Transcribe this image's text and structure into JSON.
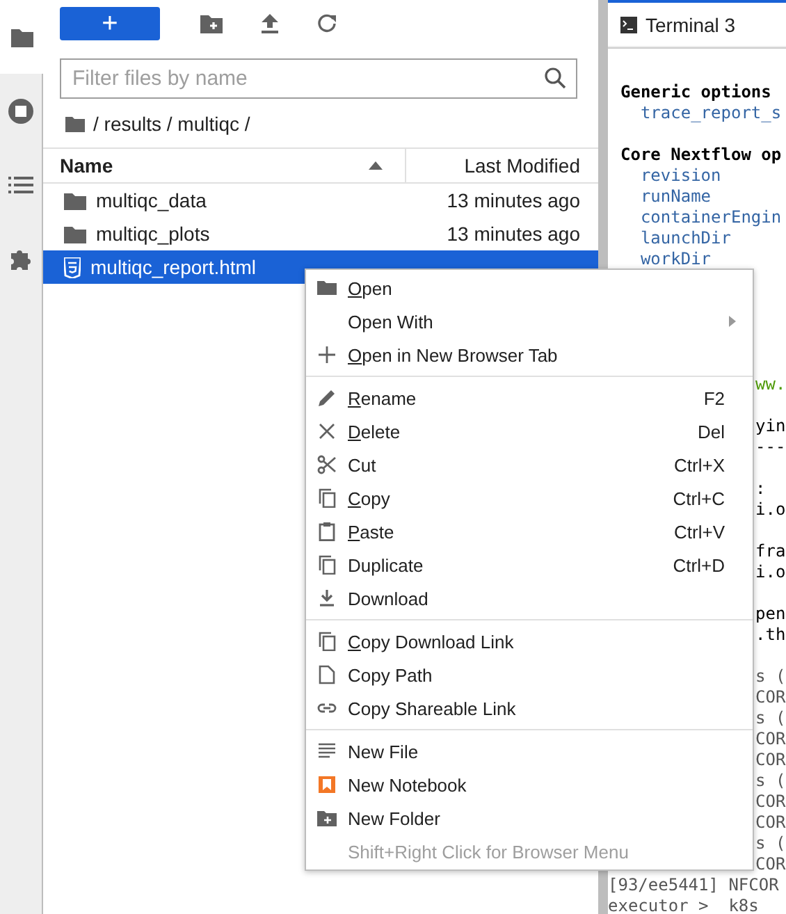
{
  "sidebar": {
    "tabs": [
      {
        "selected": true
      },
      {
        "selected": false
      },
      {
        "selected": false
      },
      {
        "selected": false
      }
    ]
  },
  "file_browser": {
    "toolbar": {
      "new_button": "+"
    },
    "filter": {
      "placeholder": "Filter files by name"
    },
    "breadcrumb": "/ results / multiqc /",
    "columns": [
      {
        "label": "Name",
        "sorted": true
      },
      {
        "label": "Last Modified",
        "sorted": false
      }
    ],
    "rows": [
      {
        "kind": "folder",
        "name": "multiqc_data",
        "modified": "13 minutes ago",
        "selected": false
      },
      {
        "kind": "folder",
        "name": "multiqc_plots",
        "modified": "13 minutes ago",
        "selected": false
      },
      {
        "kind": "html",
        "name": "multiqc_report.html",
        "selected": true
      }
    ]
  },
  "terminal": {
    "tab": "Terminal 3",
    "lines": [
      {
        "kind": "heading",
        "text": "Generic options"
      },
      {
        "kind": "option",
        "text": "  trace_report_s"
      },
      {
        "kind": "blank"
      },
      {
        "kind": "heading",
        "text": "Core Nextflow op"
      },
      {
        "kind": "option",
        "text": "  revision"
      },
      {
        "kind": "option",
        "text": "  runName"
      },
      {
        "kind": "option",
        "text": "  containerEngin"
      },
      {
        "kind": "option",
        "text": "  launchDir"
      },
      {
        "kind": "option",
        "text": "  workDir"
      },
      {
        "kind": "blank"
      },
      {
        "kind": "blank"
      },
      {
        "kind": "blank"
      },
      {
        "kind": "blank"
      },
      {
        "kind": "blank"
      },
      {
        "kind": "link_fragment",
        "text": "ww."
      },
      {
        "kind": "blank"
      },
      {
        "kind": "fragment",
        "text": "yin"
      },
      {
        "kind": "fragment",
        "text": "---"
      },
      {
        "kind": "blank"
      },
      {
        "kind": "fragment",
        "text": ":"
      },
      {
        "kind": "fragment",
        "text": "i.o"
      },
      {
        "kind": "blank"
      },
      {
        "kind": "fragment",
        "text": "fra"
      },
      {
        "kind": "fragment",
        "text": "i.o"
      },
      {
        "kind": "blank"
      },
      {
        "kind": "fragment",
        "text": "pen"
      },
      {
        "kind": "fragment",
        "text": ".th"
      },
      {
        "kind": "blank"
      },
      {
        "kind": "log_fragment",
        "text": "s ("
      },
      {
        "kind": "log_fragment",
        "text": "COR"
      },
      {
        "kind": "log_fragment",
        "text": "s ("
      },
      {
        "kind": "log_fragment",
        "text": "COR"
      },
      {
        "kind": "log_fragment",
        "text": "COR"
      },
      {
        "kind": "log_fragment",
        "text": "s ("
      },
      {
        "kind": "log_fragment",
        "text": "COR"
      },
      {
        "kind": "log_fragment",
        "text": "COR"
      },
      {
        "kind": "log_fragment",
        "text": "s ("
      },
      {
        "kind": "log_fragment",
        "text": "COR"
      },
      {
        "kind": "log",
        "text": "[93/ee5441] NFCOR"
      },
      {
        "kind": "log",
        "text": "executor >  k8s"
      }
    ]
  },
  "context_menu": {
    "sections": [
      [
        {
          "label": "Open",
          "mnemonic": true
        },
        {
          "label": "Open With",
          "submenu": true
        },
        {
          "label": "Open in New Browser Tab",
          "mnemonic": true
        }
      ],
      [
        {
          "label": "Rename",
          "mnemonic": true,
          "shortcut": "F2"
        },
        {
          "label": "Delete",
          "mnemonic": true,
          "shortcut": "Del"
        },
        {
          "label": "Cut",
          "shortcut": "Ctrl+X"
        },
        {
          "label": "Copy",
          "mnemonic": true,
          "shortcut": "Ctrl+C"
        },
        {
          "label": "Paste",
          "mnemonic": true,
          "shortcut": "Ctrl+V"
        },
        {
          "label": "Duplicate",
          "shortcut": "Ctrl+D"
        },
        {
          "label": "Download"
        }
      ],
      [
        {
          "label": "Copy Download Link",
          "mnemonic": true
        },
        {
          "label": "Copy Path"
        },
        {
          "label": "Copy Shareable Link"
        }
      ],
      [
        {
          "label": "New File"
        },
        {
          "label": "New Notebook"
        },
        {
          "label": "New Folder"
        },
        {
          "label": "Shift+Right Click for Browser Menu",
          "disabled": true
        }
      ]
    ]
  }
}
